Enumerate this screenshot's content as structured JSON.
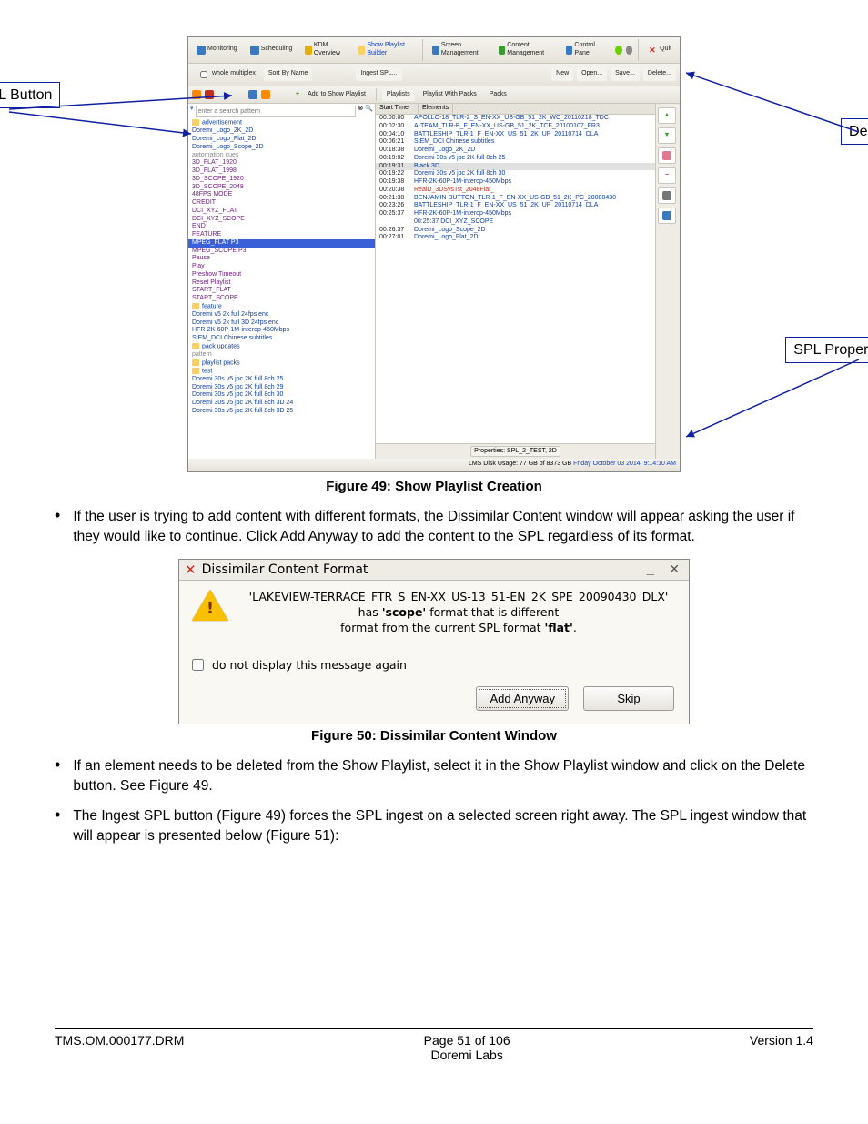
{
  "callouts": {
    "ingest": "Ingest SPL Button",
    "delete": "Delete Button",
    "props": "SPL Properties Button"
  },
  "app": {
    "top_tabs": [
      "Monitoring",
      "Scheduling",
      "KDM Overview",
      "Show Playlist Builder",
      "Screen Management",
      "Content Management",
      "Control Panel"
    ],
    "quit": "Quit",
    "row2": {
      "whole": "whole multiplex",
      "sort": "Sort By Name",
      "ingest": "Ingest SPL...",
      "new": "New",
      "open": "Open...",
      "save": "Save...",
      "delete": "Delete..."
    },
    "row3": {
      "addbtn": "Add to Show Playlist",
      "tabs": [
        "Playlists",
        "Playlist With Packs",
        "Packs"
      ]
    },
    "search_placeholder": "enter a search pattern",
    "left_items": [
      {
        "t": "advertisement",
        "cls": "folder"
      },
      {
        "t": "Doremi_Logo_2K_2D"
      },
      {
        "t": "Doremi_Logo_Flat_2D"
      },
      {
        "t": "Doremi_Logo_Scope_2D"
      },
      {
        "t": "automation cues",
        "cls": "grey"
      },
      {
        "t": "3D_FLAT_1920",
        "cls": "purple"
      },
      {
        "t": "3D_FLAT_1998",
        "cls": "purple"
      },
      {
        "t": "3D_SCOPE_1920",
        "cls": "purple"
      },
      {
        "t": "3D_SCOPE_2048",
        "cls": "purple"
      },
      {
        "t": "48FPS MODE",
        "cls": "purple"
      },
      {
        "t": "CREDIT",
        "cls": "purple"
      },
      {
        "t": "DCI_XYZ_FLAT",
        "cls": "purple"
      },
      {
        "t": "DCI_XYZ_SCOPE",
        "cls": "purple"
      },
      {
        "t": "END",
        "cls": "purple"
      },
      {
        "t": "FEATURE",
        "cls": "purple"
      },
      {
        "t": "MPEG_FLAT P3",
        "cls": "sel"
      },
      {
        "t": "MPEG_SCOPE P3",
        "cls": "purple"
      },
      {
        "t": "Pause",
        "cls": "purple"
      },
      {
        "t": "Play",
        "cls": "purple"
      },
      {
        "t": "Preshow Timeout",
        "cls": "purple"
      },
      {
        "t": "Reset Playlist",
        "cls": "purple"
      },
      {
        "t": "START_FLAT",
        "cls": "purple"
      },
      {
        "t": "START_SCOPE",
        "cls": "purple"
      },
      {
        "t": "feature",
        "cls": "folder"
      },
      {
        "t": "Doremi v5 2k full 24fps enc"
      },
      {
        "t": "Doremi v5 2k full 3D 24fps enc"
      },
      {
        "t": "HFR-2K-60P-1M-interop-450Mbps"
      },
      {
        "t": "StEM_DCI Chinese subtitles"
      },
      {
        "t": "pack updates",
        "cls": "folder"
      },
      {
        "t": "pattern",
        "cls": "grey"
      },
      {
        "t": "playlist packs",
        "cls": "folder"
      },
      {
        "t": "test",
        "cls": "folder"
      },
      {
        "t": "Doremi 30s v5 jpc 2K full 8ch 25"
      },
      {
        "t": "Doremi 30s v5 jpc 2K full 8ch 29"
      },
      {
        "t": "Doremi 30s v5 jpc 2K full 8ch 30"
      },
      {
        "t": "Doremi 30s v5 jpc 2K full 8ch 3D 24"
      },
      {
        "t": "Doremi 30s v5 jpc 2K full 8ch 3D 25"
      }
    ],
    "rp_cols": [
      "Start Time",
      "Elements"
    ],
    "rp_rows": [
      {
        "t": "00:00:00",
        "n": "APOLLO-18_TLR-2_S_EN-XX_US-GB_51_2K_WC_20110218_TDC"
      },
      {
        "t": "00:02:30",
        "n": "A-TEAM_TLR-B_F_EN-XX_US-GB_51_2K_TCF_20100107_FR3"
      },
      {
        "t": "00:04:10",
        "n": "BATTLESHIP_TLR-1_F_EN-XX_US_51_2K_UP_20110714_DLA"
      },
      {
        "t": "00:06:21",
        "n": "StEM_DCI Chinese subtitles"
      },
      {
        "t": "00:18:38",
        "n": "Doremi_Logo_2K_2D"
      },
      {
        "t": "00:19:02",
        "n": "Doremi 30s v5 jpc 2K full 8ch 25"
      },
      {
        "t": "00:19:31",
        "n": "Black 3D",
        "cls": "sel"
      },
      {
        "t": "00:19:22",
        "n": "Doremi 30s v5 jpc 2K full 8ch 30"
      },
      {
        "t": "00:19:38",
        "n": "HFR-2K-60P-1M-interop-450Mbps"
      },
      {
        "t": "00:20:38",
        "n": "RealD_3DSysTst_2048Flat_",
        "cls": "red"
      },
      {
        "t": "00:21:38",
        "n": "BENJAMIN-BUTTON_TLR-1_F_EN-XX_US-GB_51_2K_PC_20080430"
      },
      {
        "t": "00:23:26",
        "n": "BATTLESHIP_TLR-1_F_EN-XX_US_51_2K_UP_20110714_DLA"
      },
      {
        "t": "00:25:37",
        "n": "HFR-2K-60P-1M-interop-450Mbps"
      },
      {
        "t": "",
        "n": "00:25:37 DCI_XYZ_SCOPE"
      },
      {
        "t": "00:26:37",
        "n": "Doremi_Logo_Scope_2D"
      },
      {
        "t": "00:27:01",
        "n": "Doremi_Logo_Flat_2D"
      }
    ],
    "props_btn": "Properties: SPL_2_TEST, 2D",
    "status_usage": "LMS Disk Usage: 77 GB of 8373 GB",
    "status_time": "Friday October 03 2014, 9:14:10 AM"
  },
  "fig49_caption": "Figure 49: Show Playlist Creation",
  "bullet_before_dialog": "If the user is trying to add content with different formats, the Dissimilar Content window will appear asking the user if they would like to continue. Click Add Anyway to add the content to the SPL regardless of its format.",
  "dialog": {
    "title": "Dissimilar Content Format",
    "line1": "'LAKEVIEW-TERRACE_FTR_S_EN-XX_US-13_51-EN_2K_SPE_20090430_DLX'",
    "line2a": "has ",
    "line2b": "'scope'",
    "line2c": " format that is different",
    "line3a": "format from the current SPL format ",
    "line3b": "'flat'",
    "line3c": ".",
    "check": "do not display this message again",
    "add": "Add Anyway",
    "add_u": "A",
    "skip": "Skip",
    "skip_u": "S",
    "skip_rest": "kip"
  },
  "fig50_caption": "Figure 50: Dissimilar Content Window",
  "bullets_after": [
    "If an element needs to be deleted from the Show Playlist, select it in the Show Playlist window and click on the Delete button. See Figure 49.",
    "The Ingest SPL button (Figure 49) forces the SPL ingest on a selected screen right away. The SPL ingest window that will appear is presented below (Figure 51):"
  ],
  "footer": {
    "left": "TMS.OM.000177.DRM",
    "mid1": "Page 51 of 106",
    "mid2": "Doremi Labs",
    "right": "Version 1.4"
  }
}
